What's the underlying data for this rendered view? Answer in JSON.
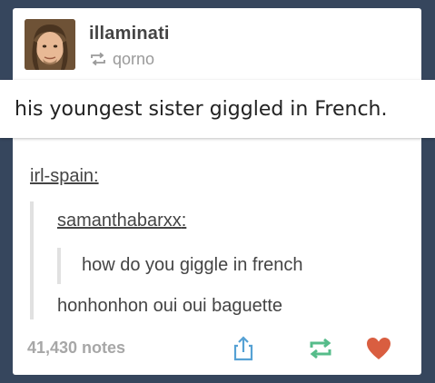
{
  "post": {
    "username": "illaminati",
    "reblogged_from": "qorno",
    "quote": "his youngest sister giggled in French.",
    "thread": {
      "author1": "irl-spain",
      "author2": "samanthabarxx",
      "message1": "how do you giggle in french",
      "message2": "honhonhon oui oui baguette",
      "colon": ":"
    },
    "notes": "41,430 notes"
  },
  "colors": {
    "dashboard_bg": "#36465d",
    "reblog_green": "#56bc8a",
    "heart_red": "#d95e40",
    "share_blue": "#56a1d4"
  },
  "icons": [
    "avatar",
    "reblog-small-icon",
    "share-icon",
    "reblog-icon",
    "heart-icon"
  ]
}
